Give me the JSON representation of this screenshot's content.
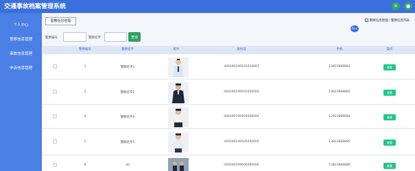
{
  "header": {
    "title": "交通事故档案管理系统",
    "close_icon": "close-icon",
    "user_icon": "user-icon"
  },
  "sidebar": {
    "items": [
      {
        "label": "个人中心"
      },
      {
        "label": "警察信息管理"
      },
      {
        "label": "事故信息管理"
      },
      {
        "label": "申诉信息管理"
      }
    ]
  },
  "main": {
    "tab_label": "警察信息管理",
    "breadcrumb": [
      "警察信息管理",
      "警察信息列表"
    ],
    "avatar_text": "Ro.c",
    "search": {
      "field1_label": "警察编号",
      "field1_value": "",
      "field2_label": "警察名字",
      "field2_value": "",
      "button_label": "查询"
    },
    "columns": [
      "警察编号",
      "警察名字",
      "照片",
      "身份证",
      "手机",
      "操作"
    ],
    "rows": [
      {
        "id": "1",
        "name": "警察名字1",
        "id_card": "440300199101010001",
        "phone": "13823888881",
        "action": "查看"
      },
      {
        "id": "2",
        "name": "警察名字2",
        "id_card": "440300199202020002",
        "phone": "13823888882",
        "action": "查看"
      },
      {
        "id": "4",
        "name": "警察名字4",
        "id_card": "440300199404040004",
        "phone": "13823888884",
        "action": "查看"
      },
      {
        "id": "5",
        "name": "警察名字5",
        "id_card": "440300199505050005",
        "phone": "13823888885",
        "action": "查看"
      },
      {
        "id": "6",
        "name": "dd",
        "id_card": "440300199606060006",
        "phone": "13823888886",
        "action": "查看"
      }
    ]
  },
  "colors": {
    "header": "#3a6fdc",
    "sidebar": "#4a7fe5",
    "search_button": "#2f9e64",
    "action_button": "#22c58b"
  }
}
